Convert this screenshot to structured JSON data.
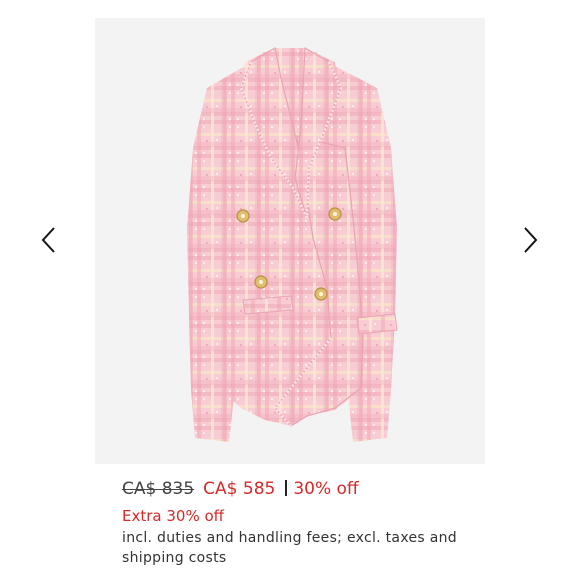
{
  "product": {
    "image_alt": "Pink tweed double-breasted blazer",
    "image_background": "#f3f3f3",
    "fabric_color": "#f5c4cc",
    "button_color": "#d9b56a"
  },
  "gallery": {
    "prev_icon": "chevron-left-icon",
    "next_icon": "chevron-right-icon"
  },
  "pricing": {
    "original_price": "CA$ 835",
    "sale_price": "CA$ 585",
    "discount": "30% off",
    "extra_discount": "Extra 30% off",
    "duties_note": "incl. duties and handling fees; excl. taxes and shipping costs",
    "sale_color": "#d42a2a"
  }
}
